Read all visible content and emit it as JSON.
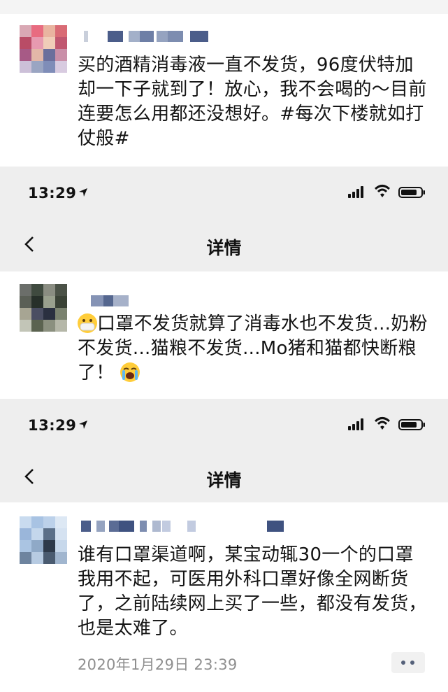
{
  "posts": [
    {
      "text": "买的酒精消毒液一直不发货，96度伏特加却一下子就到了！放心，我不会喝的～目前连要怎么用都还没想好。#每次下楼就如打仗般#"
    },
    {
      "text_part1": "口罩不发货就算了消毒水也不发货...奶粉不发货...猫粮不发货...Mo猪和猫都快断粮了！",
      "emoji_start": "mask-face-emoji",
      "emoji_end": "crying-face-emoji"
    },
    {
      "text": "谁有口罩渠道啊，某宝动辄30一个的口罩我用不起，可医用外科口罩好像全网断货了，之前陆续网上买了一些，都没有发货，也是太难了。",
      "timestamp": "2020年1月29日 23:39"
    }
  ],
  "status_bars": [
    {
      "time": "13:29",
      "icons": [
        "location-arrow-icon",
        "signal-icon",
        "wifi-icon",
        "battery-icon"
      ]
    },
    {
      "time": "13:29",
      "icons": [
        "location-arrow-icon",
        "signal-icon",
        "wifi-icon",
        "battery-icon"
      ]
    }
  ],
  "nav_bars": [
    {
      "title": "详情",
      "back_icon": "chevron-left-icon"
    },
    {
      "title": "详情",
      "back_icon": "chevron-left-icon"
    }
  ],
  "more_button_icon": "more-dots-icon",
  "colors": {
    "background_gray": "#eeeeee",
    "timestamp_gray": "#8f8f8f",
    "dots": "#55617a"
  }
}
